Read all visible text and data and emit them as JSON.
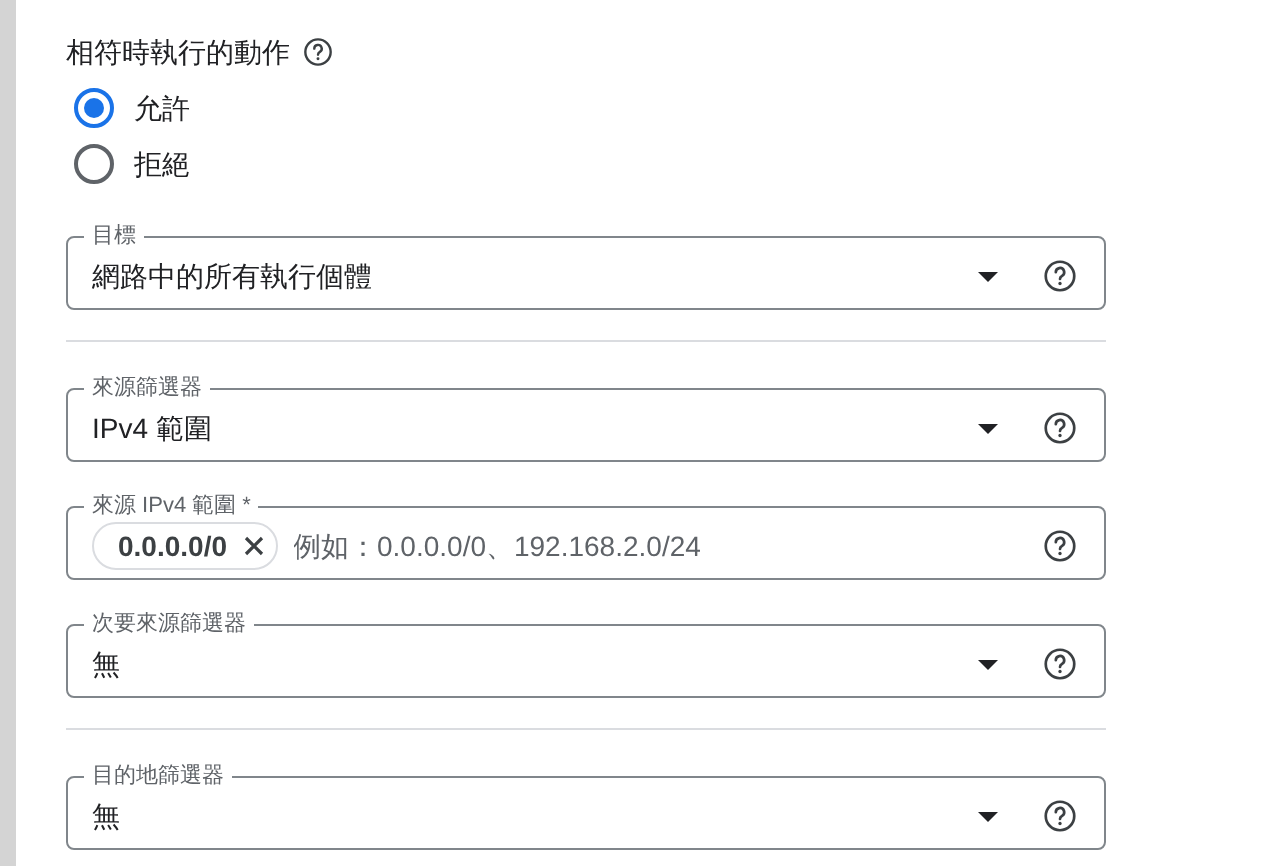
{
  "action": {
    "title": "相符時執行的動作",
    "options": [
      {
        "label": "允許",
        "selected": true
      },
      {
        "label": "拒絕",
        "selected": false
      }
    ]
  },
  "sections": [
    [
      {
        "kind": "select",
        "label": "目標",
        "value": "網路中的所有執行個體"
      }
    ],
    [
      {
        "kind": "select",
        "label": "來源篩選器",
        "value": "IPv4 範圍"
      },
      {
        "kind": "chips",
        "label": "來源 IPv4 範圍 *",
        "chips": [
          "0.0.0.0/0"
        ],
        "placeholder": "例如：0.0.0.0/0、192.168.2.0/24"
      },
      {
        "kind": "select",
        "label": "次要來源篩選器",
        "value": "無"
      }
    ],
    [
      {
        "kind": "select",
        "label": "目的地篩選器",
        "value": "無"
      }
    ]
  ]
}
